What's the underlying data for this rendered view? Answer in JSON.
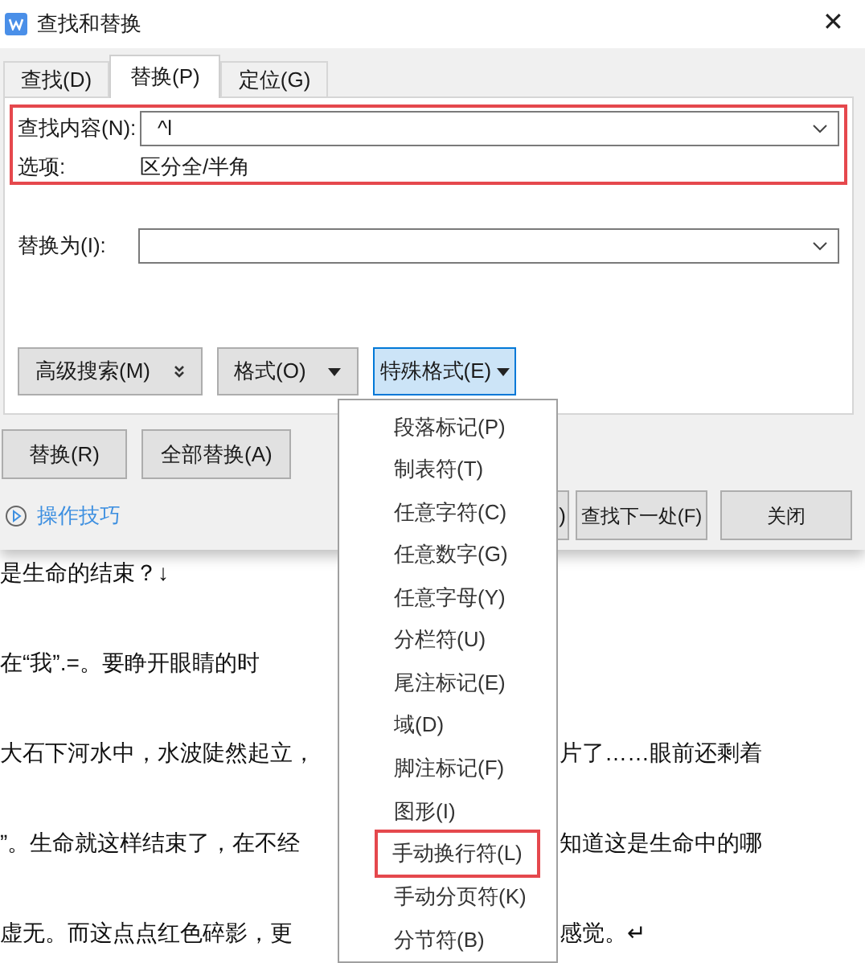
{
  "window": {
    "title": "查找和替换",
    "close": "✕"
  },
  "tabs": [
    {
      "label": "查找(D)",
      "selected": false
    },
    {
      "label": "替换(P)",
      "selected": true
    },
    {
      "label": "定位(G)",
      "selected": false
    }
  ],
  "find": {
    "label": "查找内容(N):",
    "value": "^l",
    "outlined": true
  },
  "options": {
    "label": "选项:",
    "value": "区分全/半角"
  },
  "replace": {
    "label": "替换为(I):"
  },
  "format_buttons": [
    {
      "label": "高级搜索(M)",
      "kind": "double",
      "selected": false
    },
    {
      "label": "格式(O)",
      "kind": "caret",
      "selected": false
    },
    {
      "label": "特殊格式(E)",
      "kind": "caret",
      "selected": true
    }
  ],
  "replace_buttons": [
    "替换(R)",
    "全部替换(A)"
  ],
  "tips_link": "操作技巧",
  "action_buttons": [
    {
      "label": ")",
      "kind": "partial"
    },
    {
      "label": "查找下一处(F)",
      "kind": "full"
    },
    {
      "label": "关闭",
      "kind": "full"
    }
  ],
  "special_menu": [
    {
      "label": "段落标记(P)",
      "outlined": false
    },
    {
      "label": "制表符(T)",
      "outlined": false
    },
    {
      "label": "任意字符(C)",
      "outlined": false
    },
    {
      "label": "任意数字(G)",
      "outlined": false
    },
    {
      "label": "任意字母(Y)",
      "outlined": false
    },
    {
      "label": "分栏符(U)",
      "outlined": false
    },
    {
      "label": "尾注标记(E)",
      "outlined": false
    },
    {
      "label": "域(D)",
      "outlined": false
    },
    {
      "label": "脚注标记(F)",
      "outlined": false
    },
    {
      "label": "图形(I)",
      "outlined": false
    },
    {
      "label": "手动换行符(L)",
      "outlined": true
    },
    {
      "label": "手动分页符(K)",
      "outlined": false
    },
    {
      "label": "分节符(B)",
      "outlined": false
    }
  ],
  "document_lines": [
    {
      "left": "是生命的结束？↓"
    },
    {
      "left": "在“我”.=。要睁开眼睛的时"
    },
    {
      "left": "大石下河水中，水波陡然起立，",
      "right": "片了……眼前还剩着"
    },
    {
      "left": "”。生命就这样结束了，在不经",
      "right": "知道这是生命中的哪"
    },
    {
      "left": "虚无。而这点点红色碎影，更",
      "right": "感觉。↵"
    }
  ]
}
